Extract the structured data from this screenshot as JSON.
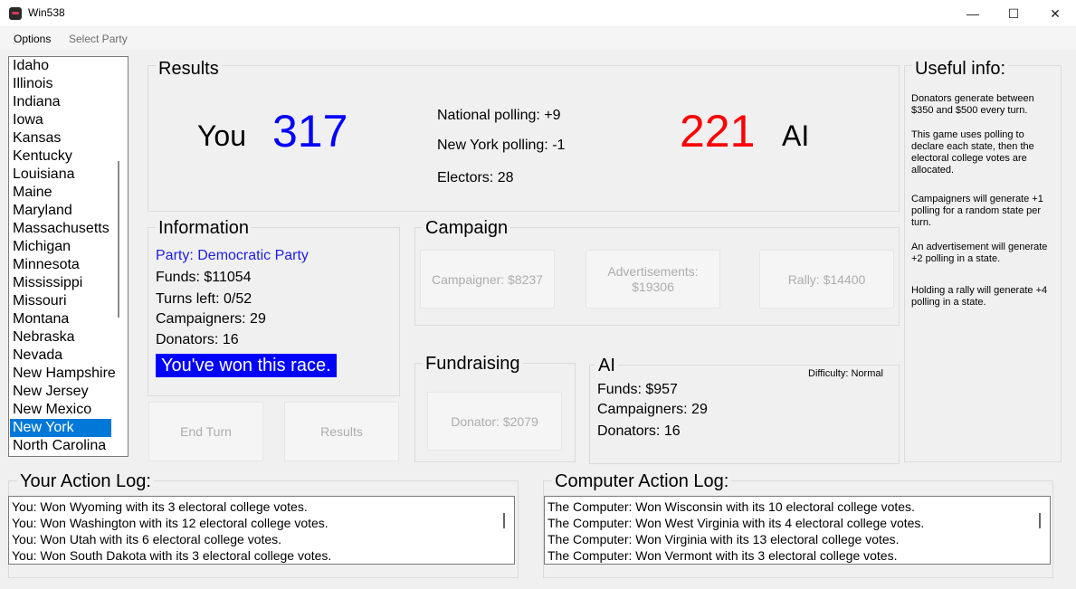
{
  "window": {
    "title": "Win538",
    "minimize_glyph": "—",
    "maximize_glyph": "☐",
    "close_glyph": "✕"
  },
  "menu": {
    "options": "Options",
    "select_party": "Select Party"
  },
  "states": [
    "Idaho",
    "Illinois",
    "Indiana",
    "Iowa",
    "Kansas",
    "Kentucky",
    "Louisiana",
    "Maine",
    "Maryland",
    "Massachusetts",
    "Michigan",
    "Minnesota",
    "Mississippi",
    "Missouri",
    "Montana",
    "Nebraska",
    "Nevada",
    "New Hampshire",
    "New Jersey",
    "New Mexico",
    "New York",
    "North Carolina"
  ],
  "selected_state": "New York",
  "results": {
    "title": "Results",
    "you_label": "You",
    "you_score": "317",
    "ai_score": "221",
    "ai_label": "AI",
    "national_polling": "National polling: +9",
    "state_polling": "New York polling: -1",
    "electors": "Electors: 28"
  },
  "information": {
    "title": "Information",
    "party": "Party: Democratic Party",
    "funds": "Funds: $11054",
    "turns": "Turns left: 0/52",
    "campaigners": "Campaigners: 29",
    "donators": "Donators: 16",
    "status": "You've won this race."
  },
  "buttons": {
    "end_turn": "End Turn",
    "results": "Results"
  },
  "campaign": {
    "title": "Campaign",
    "campaigner": "Campaigner: $8237",
    "advertisements": "Advertisements: $19306",
    "rally": "Rally: $14400"
  },
  "fundraising": {
    "title": "Fundraising",
    "donator": "Donator: $2079"
  },
  "ai": {
    "title": "AI",
    "difficulty": "Difficulty: Normal",
    "funds": "Funds: $957",
    "campaigners": "Campaigners: 29",
    "donators": "Donators: 16"
  },
  "useful_info": {
    "title": "Useful info:",
    "tips": [
      "Donators generate between $350 and $500 every turn.",
      "This game uses polling to declare each state, then the electoral college votes are allocated.",
      "Campaigners will generate +1 polling for a random state per turn.",
      "An advertisement will generate +2 polling in a state.",
      "Holding a rally will generate +4 polling in a state."
    ]
  },
  "user_log": {
    "title": "Your Action Log:",
    "lines": [
      "You: Won Wyoming with its 3 electoral college votes.",
      "You: Won Washington with its 12 electoral college votes.",
      "You: Won Utah with its 6 electoral college votes.",
      "You: Won South Dakota with its 3 electoral college votes."
    ]
  },
  "computer_log": {
    "title": "Computer Action Log:",
    "lines": [
      "The Computer: Won Wisconsin with its 10 electoral college votes.",
      "The Computer: Won West Virginia with its 4 electoral college votes.",
      "The Computer: Won Virginia with its 13 electoral college votes.",
      "The Computer: Won Vermont with its 3 electoral college votes."
    ]
  },
  "colors": {
    "you": "#0000ff",
    "ai": "#ff0000",
    "selection": "#0078d7",
    "banner": "#0000ff"
  }
}
